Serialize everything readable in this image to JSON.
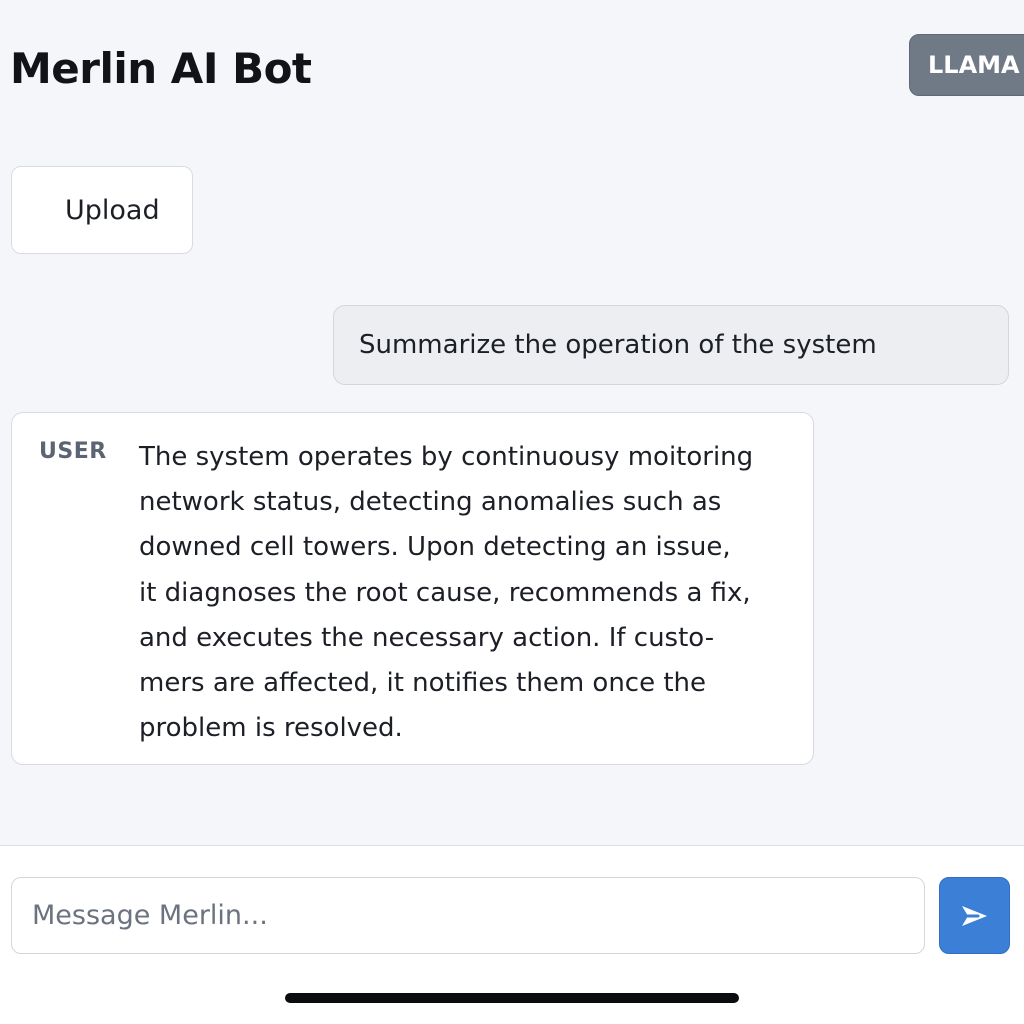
{
  "header": {
    "title": "Merlin AI Bot",
    "model_badge": "LLAMA"
  },
  "toolbar": {
    "upload_label": "Upload"
  },
  "conversation": {
    "user_message": "Summarize the operation of the system",
    "bot_reply": {
      "sender": "USER",
      "lines": [
        "The system operates by continuousy moitoring",
        "network status, detecting anomalies such as",
        "downed cell towers. Upon detecting an issue,",
        "it diagnoses the root cause, recommends a fix,",
        "and executes the necessary action. If custo-",
        "mers are affected, it notifies them once the",
        "problem is resolved."
      ]
    }
  },
  "composer": {
    "placeholder": "Message Merlin...",
    "value": "",
    "send_icon": "send-arrow-icon"
  },
  "colors": {
    "background": "#f5f6fa",
    "badge": "#707a87",
    "send_button": "#3b7fd6",
    "user_bubble": "#eceef2"
  }
}
